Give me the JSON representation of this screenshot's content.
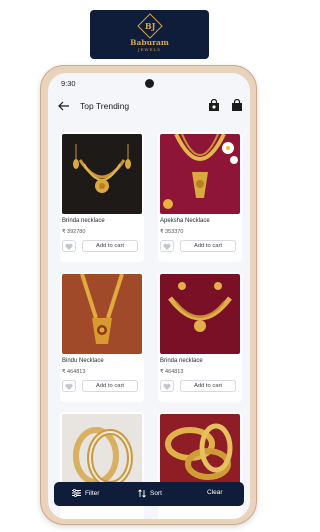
{
  "brand": {
    "monogram": "BJ",
    "name": "Baburam",
    "subtitle": "JEWELS",
    "color": "#d4a94b",
    "bg": "#0f1d3a"
  },
  "status": {
    "time": "9:30"
  },
  "appbar": {
    "title": "Top Trending",
    "back_icon": "arrow-left-icon",
    "icons": [
      "shopping-bag-icon",
      "shopping-bag-icon"
    ]
  },
  "products": [
    {
      "name": "Brinda necklace",
      "price": "₹ 392780",
      "add_label": "Add to cart"
    },
    {
      "name": "Apeksha Necklace",
      "price": "₹ 353370",
      "add_label": "Add to cart"
    },
    {
      "name": "Bindu Necklace",
      "price": "₹ 464813",
      "add_label": "Add to cart"
    },
    {
      "name": "Brinda necklace",
      "price": "₹ 464813",
      "add_label": "Add to cart"
    },
    {
      "name": "",
      "price": "",
      "add_label": ""
    },
    {
      "name": "",
      "price": "",
      "add_label": ""
    }
  ],
  "bottom_bar": {
    "filter": "Filter",
    "sort": "Sort",
    "clear": "Clear"
  },
  "colors": {
    "accent": "#0f1d3a",
    "gold": "#d4a94b",
    "background": "#f4f6f9"
  }
}
